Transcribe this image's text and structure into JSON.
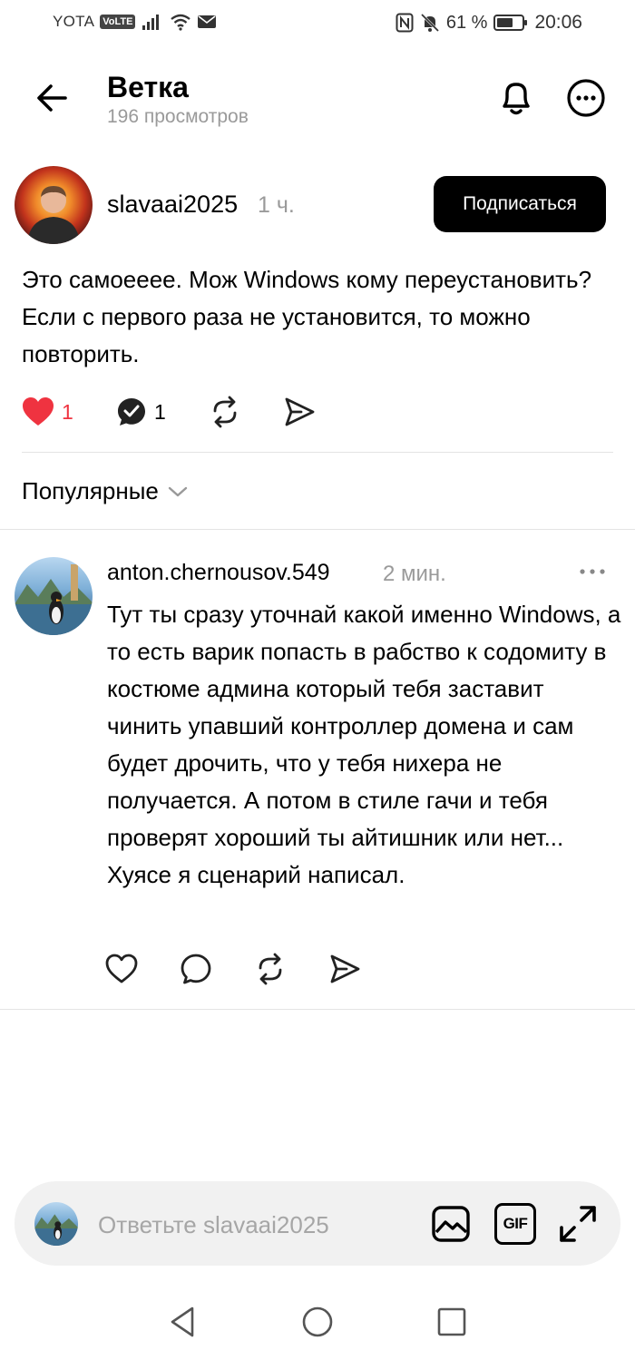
{
  "status_bar": {
    "carrier": "YOTA",
    "network_badge": "VoLTE",
    "battery": "61 %",
    "time": "20:06"
  },
  "header": {
    "title": "Ветка",
    "subtitle": "196 просмотров"
  },
  "post": {
    "author": "slavaai2025",
    "time": "1 ч.",
    "follow_label": "Подписаться",
    "text": "Это самоееее. Мож Windows кому переустановить? Если с первого раза не установится, то можно повторить.",
    "likes": "1",
    "replies": "1"
  },
  "sort": {
    "label": "Популярные"
  },
  "comment": {
    "author": "anton.chernousov.549",
    "time": "2 мин.",
    "text": "Тут ты сразу уточнай какой именно Windows, а то есть варик попасть в рабство к содомиту в костюме админа который тебя заставит чинить упавший контроллер домена и сам будет дрочить, что у тебя нихера не получается. А потом в стиле гачи и тебя проверят хороший ты айтишник или нет... Хуясе я сценарий написал."
  },
  "reply_bar": {
    "placeholder": "Ответьте slavaai2025",
    "gif_label": "GIF"
  },
  "colors": {
    "like_active": "#ef3340",
    "follow_bg": "#000000",
    "muted_text": "#9a9a9a",
    "reply_bg": "#f1f1f1"
  },
  "icons": [
    "back-arrow-icon",
    "bell-icon",
    "more-icon",
    "heart-icon",
    "comment-icon",
    "repost-icon",
    "share-icon",
    "chevron-down-icon",
    "image-icon",
    "gif-icon",
    "expand-icon"
  ]
}
